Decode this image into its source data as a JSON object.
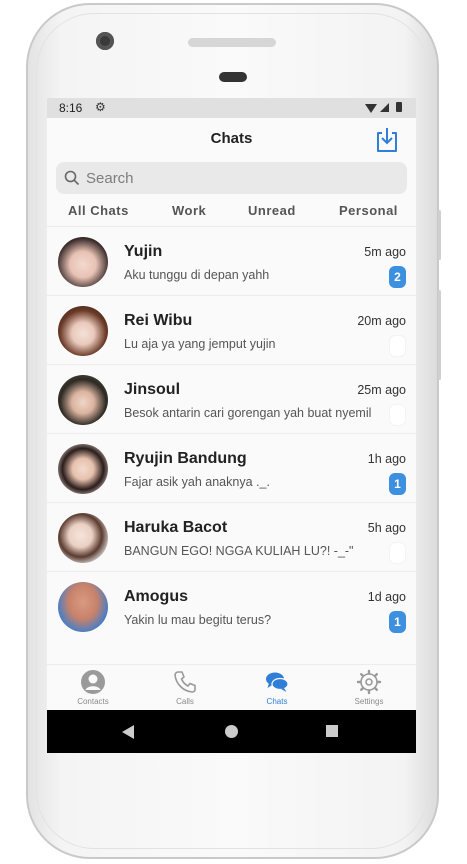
{
  "status": {
    "time": "8:16"
  },
  "header": {
    "title": "Chats"
  },
  "search": {
    "placeholder": "Search"
  },
  "tabs": [
    "All Chats",
    "Work",
    "Unread",
    "Personal"
  ],
  "chats": [
    {
      "name": "Yujin",
      "message": "Aku tunggu di depan yahh",
      "time": "5m ago",
      "unread": "2"
    },
    {
      "name": "Rei Wibu",
      "message": "Lu aja ya yang jemput yujin",
      "time": "20m ago",
      "unread": ""
    },
    {
      "name": "Jinsoul",
      "message": "Besok antarin cari gorengan yah buat nyemil",
      "time": "25m ago",
      "unread": ""
    },
    {
      "name": "Ryujin Bandung",
      "message": "Fajar asik yah anaknya ._.",
      "time": "1h ago",
      "unread": "1"
    },
    {
      "name": "Haruka Bacot",
      "message": "BANGUN EGO! NGGA KULIAH LU?! -_-\"",
      "time": "5h ago",
      "unread": ""
    },
    {
      "name": "Amogus",
      "message": "Yakin lu mau begitu terus?",
      "time": "1d ago",
      "unread": "1"
    }
  ],
  "bottom_nav": [
    {
      "label": "Contacts",
      "icon": "person-icon"
    },
    {
      "label": "Calls",
      "icon": "phone-icon"
    },
    {
      "label": "Chats",
      "icon": "chat-icon"
    },
    {
      "label": "Settings",
      "icon": "gear-icon"
    }
  ],
  "colors": {
    "accent": "#3d8fdf",
    "active_nav": "#2f7ed8"
  }
}
